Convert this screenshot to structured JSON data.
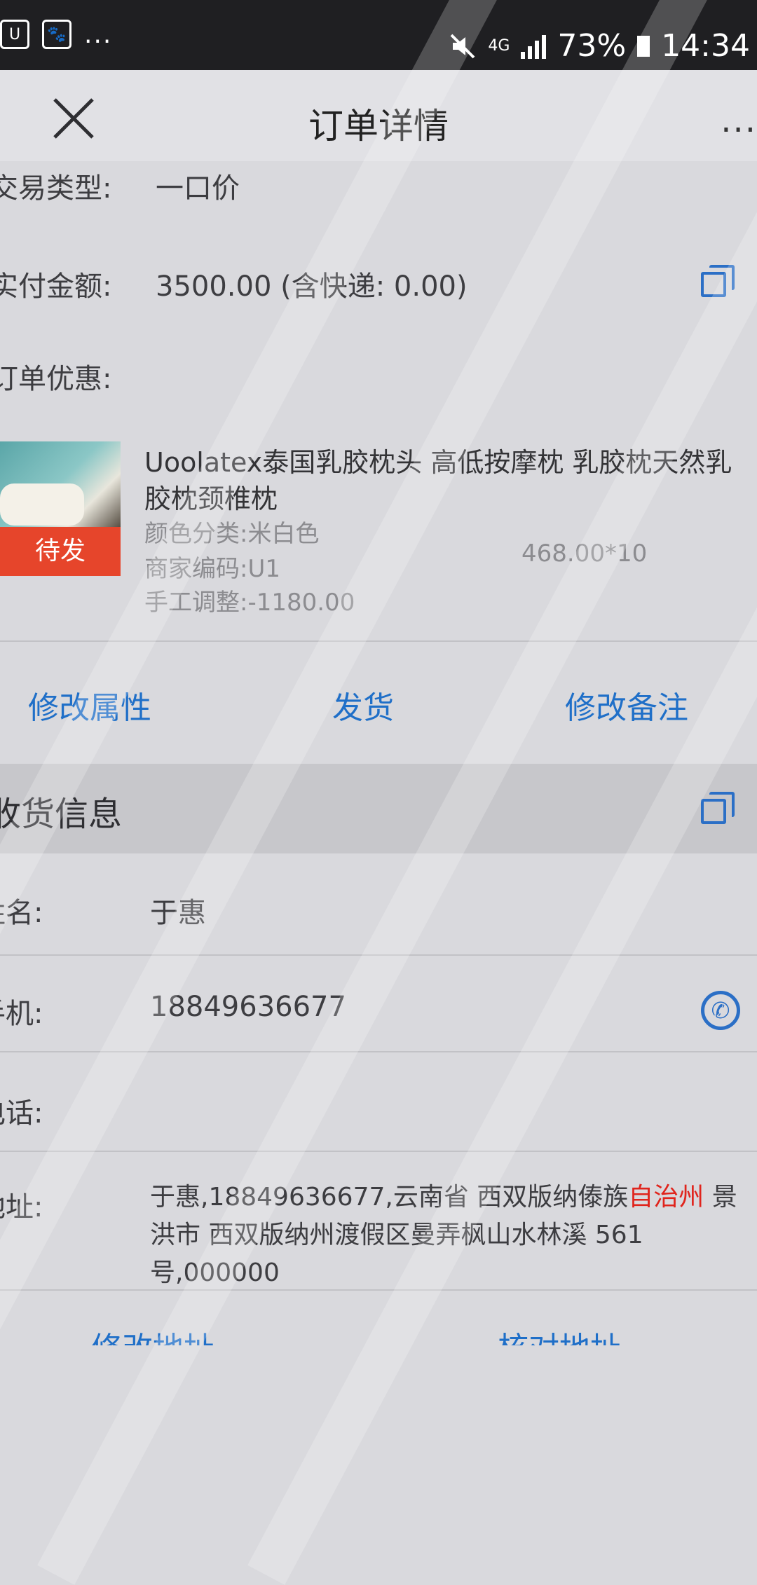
{
  "status_bar": {
    "left_icons": [
      "U",
      "🐾"
    ],
    "more": "...",
    "network": "4G",
    "battery": "73%",
    "time": "14:34"
  },
  "nav": {
    "title": "订单详情",
    "more": "..."
  },
  "order": {
    "trade_type_label": "交易类型:",
    "trade_type_value": "一口价",
    "paid_label": "实付金额:",
    "paid_value": "3500.00 (含快递: 0.00)",
    "discount_label": "订单优惠:"
  },
  "product": {
    "status_badge": "待发",
    "title": "Uoolatex泰国乳胶枕头 高低按摩枕  乳胶枕天然乳胶枕颈椎枕",
    "color": "颜色分类:米白色",
    "merchant_code": "商家编码:U1",
    "manual_adjust": "手工调整:-1180.00",
    "price_qty": "468.00*10"
  },
  "actions": {
    "modify_attr": "修改属性",
    "ship": "发货",
    "modify_note": "修改备注"
  },
  "receiver": {
    "section_title": "收货信息",
    "name_label": "姓名:",
    "name_value": "于惠",
    "mobile_label": "手机:",
    "mobile_value": "18849636677",
    "phone_label": "电话:",
    "address_label": "地址:",
    "address_part1": "于惠,18849636677,云南省 西双版纳傣族",
    "address_highlight": "自治州",
    "address_part2": " 景洪市 西双版纳州渡假区曼弄枫山水林溪 561号,000000"
  },
  "bottom_actions": {
    "modify_address": "修改地址",
    "verify_address": "核对地址"
  },
  "colors": {
    "accent_blue": "#1f6fc8",
    "badge_red": "#e6452b",
    "highlight_red": "#e0241c"
  }
}
